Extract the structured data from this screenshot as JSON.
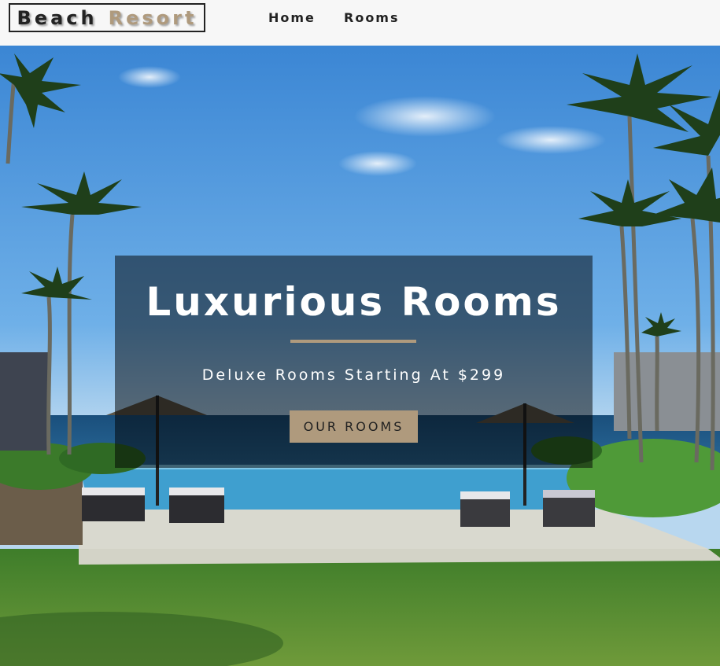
{
  "navbar": {
    "logo_word1": "Beach",
    "logo_word2": "Resort",
    "links": [
      {
        "label": "Home"
      },
      {
        "label": "Rooms"
      }
    ]
  },
  "hero": {
    "title": "Luxurious Rooms",
    "subtitle": "Deluxe Rooms Starting At $299",
    "button_label": "our rooms"
  },
  "colors": {
    "accent": "#af9a7d",
    "text_dark": "#222222",
    "navbar_bg": "#f7f7f7",
    "banner_overlay": "rgba(0,0,0,0.5)"
  }
}
